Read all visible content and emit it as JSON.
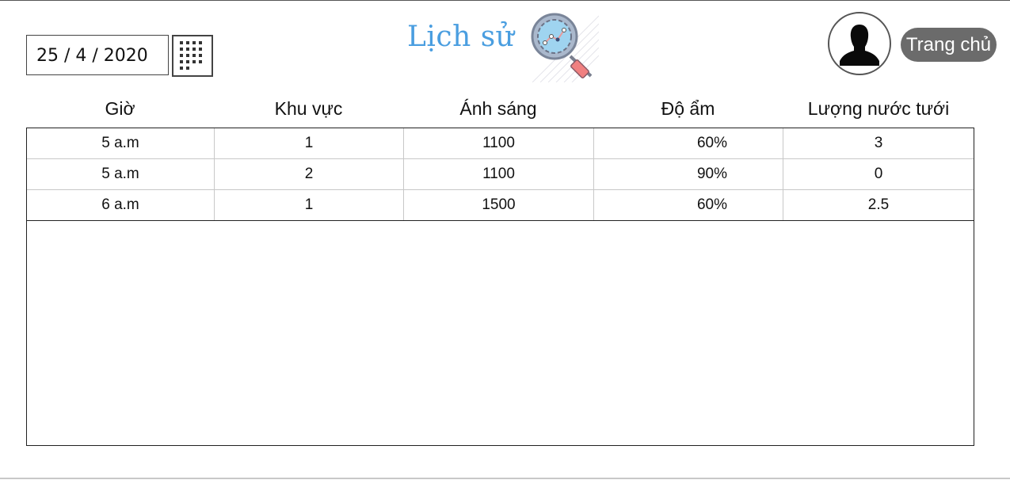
{
  "date_picker": {
    "value": "25 / 4 / 2020",
    "calendar_icon": "calendar-grid-icon"
  },
  "header": {
    "title": "Lịch sử",
    "title_color": "#4a9ee0",
    "title_icon": "magnifier-chart-icon"
  },
  "user": {
    "avatar_icon": "user-silhouette-icon",
    "home_label": "Trang chủ",
    "home_bg": "#6b6b6b"
  },
  "table": {
    "columns": [
      "Giờ",
      "Khu vực",
      "Ánh sáng",
      "Độ ẩm",
      "Lượng nước tưới"
    ],
    "rows": [
      [
        "5 a.m",
        "1",
        "1100",
        "60%",
        "3"
      ],
      [
        "5 a.m",
        "2",
        "1100",
        "90%",
        "0"
      ],
      [
        "6 a.m",
        "1",
        "1500",
        "60%",
        "2.5"
      ]
    ]
  }
}
